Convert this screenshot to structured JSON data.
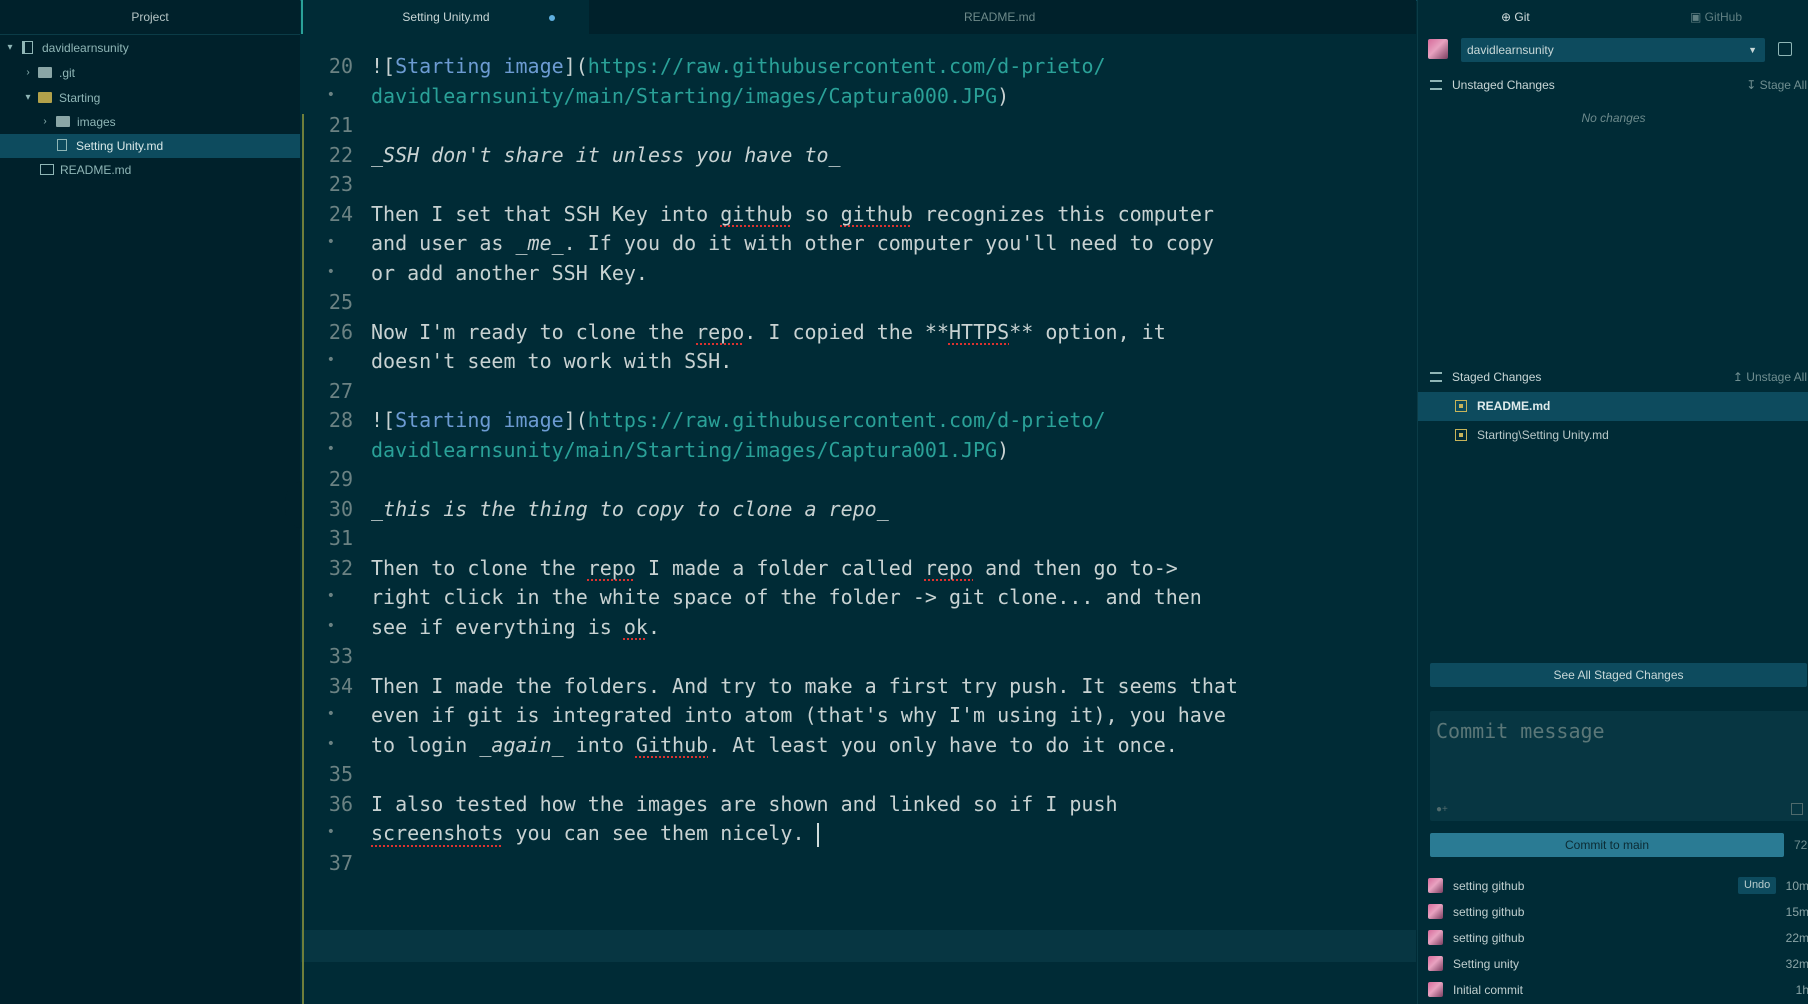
{
  "tree": {
    "header": "Project",
    "root": "davidlearnsunity",
    "items": [
      {
        "label": ".git"
      },
      {
        "label": "Starting"
      },
      {
        "label": "images"
      },
      {
        "label": "Setting Unity.md"
      },
      {
        "label": "README.md"
      }
    ]
  },
  "editor": {
    "tabs": [
      {
        "label": "Setting Unity.md"
      },
      {
        "label": "README.md"
      }
    ],
    "lines": [
      {
        "n": "20",
        "parts": [
          [
            "t",
            "!["
          ],
          [
            "lkt",
            "Starting"
          ],
          [
            "t",
            " "
          ],
          [
            "lkt",
            "image"
          ],
          [
            "t",
            "]("
          ],
          [
            "lk",
            "https://raw.githubusercontent.com/d-prieto/"
          ]
        ]
      },
      {
        "n": "•",
        "parts": [
          [
            "lk",
            "davidlearnsunity/main/Starting/images/Captura000.JPG"
          ],
          [
            "t",
            ")"
          ]
        ]
      },
      {
        "n": "21",
        "parts": []
      },
      {
        "n": "22",
        "parts": [
          [
            "it",
            "_SSH don't share it unless you have to_"
          ]
        ]
      },
      {
        "n": "23",
        "parts": []
      },
      {
        "n": "24",
        "parts": [
          [
            "t",
            "Then I set that SSH Key into "
          ],
          [
            "sp",
            "github"
          ],
          [
            "t",
            " so "
          ],
          [
            "sp",
            "github"
          ],
          [
            "t",
            " recognizes this computer"
          ]
        ]
      },
      {
        "n": "•",
        "parts": [
          [
            "t",
            "and user as "
          ],
          [
            "it",
            "_me_"
          ],
          [
            "t",
            ". If you do it with other computer you'll need to copy"
          ]
        ]
      },
      {
        "n": "•",
        "parts": [
          [
            "t",
            "or add another SSH Key."
          ]
        ]
      },
      {
        "n": "25",
        "parts": []
      },
      {
        "n": "26",
        "parts": [
          [
            "t",
            "Now I'm ready to clone the "
          ],
          [
            "sp",
            "repo"
          ],
          [
            "t",
            ". I copied the **"
          ],
          [
            "sp",
            "HTTPS"
          ],
          [
            "t",
            "** option, it"
          ]
        ]
      },
      {
        "n": "•",
        "parts": [
          [
            "t",
            "doesn't seem to work with SSH."
          ]
        ]
      },
      {
        "n": "27",
        "parts": []
      },
      {
        "n": "28",
        "parts": [
          [
            "t",
            "!["
          ],
          [
            "lkt",
            "Starting"
          ],
          [
            "t",
            " "
          ],
          [
            "lkt",
            "image"
          ],
          [
            "t",
            "]("
          ],
          [
            "lk",
            "https://raw.githubusercontent.com/d-prieto/"
          ]
        ]
      },
      {
        "n": "•",
        "parts": [
          [
            "lk",
            "davidlearnsunity/main/Starting/images/Captura001.JPG"
          ],
          [
            "t",
            ")"
          ]
        ]
      },
      {
        "n": "29",
        "parts": []
      },
      {
        "n": "30",
        "parts": [
          [
            "it",
            "_this is the thing to copy to clone a "
          ],
          [
            "it",
            "repo"
          ],
          [
            "it",
            "_"
          ]
        ]
      },
      {
        "n": "31",
        "parts": []
      },
      {
        "n": "32",
        "parts": [
          [
            "t",
            "Then to clone the "
          ],
          [
            "sp",
            "repo"
          ],
          [
            "t",
            " I made a folder called "
          ],
          [
            "sp",
            "repo"
          ],
          [
            "t",
            " and then go to->"
          ]
        ]
      },
      {
        "n": "•",
        "parts": [
          [
            "t",
            "right click in the white space of the folder -> git clone... and then"
          ]
        ]
      },
      {
        "n": "•",
        "parts": [
          [
            "t",
            "see if everything is "
          ],
          [
            "sp",
            "ok"
          ],
          [
            "t",
            "."
          ]
        ]
      },
      {
        "n": "33",
        "parts": []
      },
      {
        "n": "34",
        "parts": [
          [
            "t",
            "Then I made the folders. And try to make a first try push. It seems that"
          ]
        ]
      },
      {
        "n": "•",
        "parts": [
          [
            "t",
            "even if git is integrated into atom (that's why I'm using it), you have"
          ]
        ]
      },
      {
        "n": "•",
        "parts": [
          [
            "t",
            "to login "
          ],
          [
            "it",
            "_again_"
          ],
          [
            "t",
            " into "
          ],
          [
            "sp",
            "Github"
          ],
          [
            "t",
            ". At least you only have to do it once."
          ]
        ]
      },
      {
        "n": "35",
        "parts": []
      },
      {
        "n": "36",
        "parts": [
          [
            "t",
            "I also tested how the images are shown and linked so if I push"
          ]
        ]
      },
      {
        "n": "•",
        "parts": [
          [
            "sp",
            "screenshots"
          ],
          [
            "t",
            " you can see them nicely. "
          ]
        ]
      },
      {
        "n": "37",
        "parts": []
      }
    ]
  },
  "git": {
    "tabs": [
      {
        "label": "Git"
      },
      {
        "label": "GitHub"
      }
    ],
    "user": "davidlearnsunity",
    "unstaged_header": "Unstaged Changes",
    "stage_all": "Stage All",
    "no_changes": "No changes",
    "staged_header": "Staged Changes",
    "unstage_all": "Unstage All",
    "staged_files": [
      {
        "label": "README.md"
      },
      {
        "label": "Starting\\Setting Unity.md"
      }
    ],
    "see_all": "See All Staged Changes",
    "commit_placeholder": "Commit message",
    "commit_button": "Commit to main",
    "char_count": "72",
    "undo": "Undo",
    "history": [
      {
        "msg": "setting github",
        "time": "10m"
      },
      {
        "msg": "setting github",
        "time": "15m"
      },
      {
        "msg": "setting github",
        "time": "22m"
      },
      {
        "msg": "Setting unity",
        "time": "32m"
      },
      {
        "msg": "Initial commit",
        "time": "1h"
      }
    ]
  }
}
